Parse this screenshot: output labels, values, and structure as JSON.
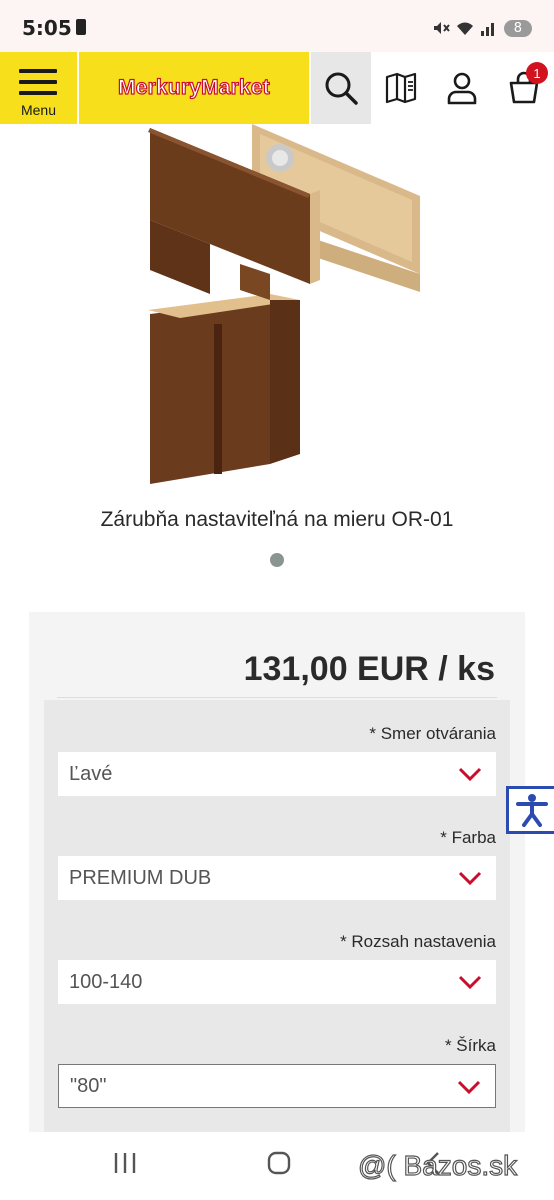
{
  "status_bar": {
    "time": "5:05",
    "battery": "8"
  },
  "header": {
    "menu_label": "Menu",
    "logo_text": "MerkuryMarket",
    "cart_count": "1",
    "icons": [
      "menu-icon",
      "search-icon",
      "catalog-icon",
      "user-icon",
      "cart-icon"
    ]
  },
  "product": {
    "title": "Zárubňa nastaviteľná na mieru OR-01",
    "price": "131,00 EUR / ks"
  },
  "options": [
    {
      "label": "* Smer otvárania",
      "value": "Ľavé"
    },
    {
      "label": "* Farba",
      "value": "PREMIUM DUB"
    },
    {
      "label": "* Rozsah nastavenia",
      "value": "100-140"
    },
    {
      "label": "* Šírka",
      "value": "\"80\""
    }
  ],
  "watermark": "@( Bazos.sk",
  "colors": {
    "brand_yellow": "#f7e01b",
    "brand_red": "#c8102e",
    "badge_red": "#d0131f",
    "chevron_red": "#c8102e"
  }
}
